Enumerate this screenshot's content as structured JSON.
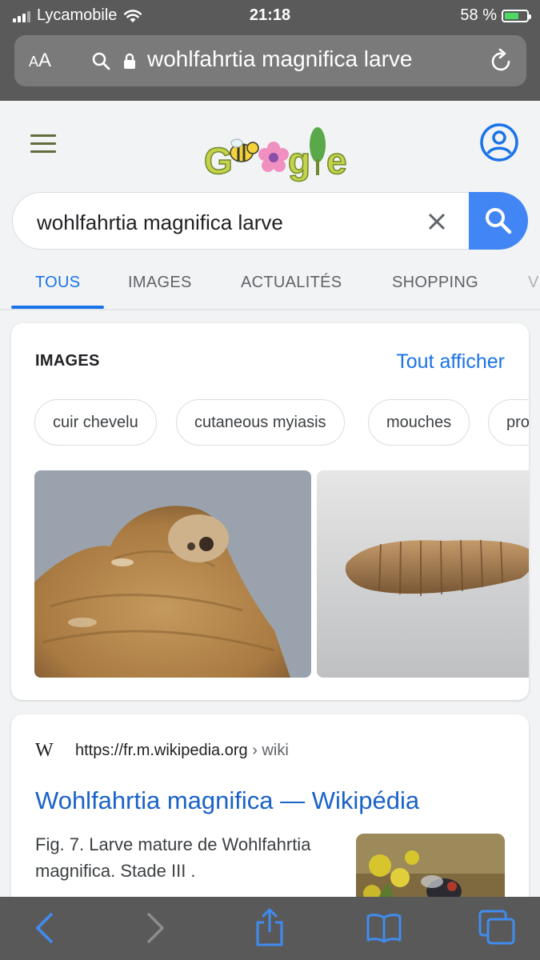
{
  "status_bar": {
    "carrier": "Lycamobile",
    "time": "21:18",
    "battery": "58 %",
    "battery_level": 0.58
  },
  "browser": {
    "text_size_label_small": "A",
    "text_size_label_large": "A",
    "url": "wohlfahrtia magnifica larve"
  },
  "google": {
    "query": "wohlfahrtia magnifica larve",
    "tabs": [
      "TOUS",
      "IMAGES",
      "ACTUALITÉS",
      "SHOPPING",
      "V"
    ],
    "active_tab": 0
  },
  "images_card": {
    "heading": "IMAGES",
    "see_all": "Tout afficher",
    "chips": [
      "cuir chevelu",
      "cutaneous myiasis",
      "mouches",
      "pro"
    ]
  },
  "result": {
    "favicon": "W",
    "url_host": "https://fr.m.wikipedia.org",
    "url_path": " › wiki",
    "title": "Wohlfahrtia magnifica — Wikipédia",
    "snippet": "Fig. 7. Larve mature de Wohlfahrtia magnifica. Stade III ."
  },
  "colors": {
    "accent": "#1a73e8",
    "search_button": "#4285f4",
    "safari_chrome": "#5a5a5a"
  }
}
